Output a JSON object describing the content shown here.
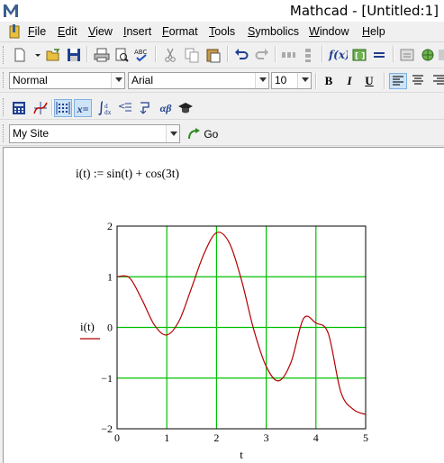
{
  "window": {
    "title": "Mathcad - [Untitled:1]"
  },
  "menu": [
    "File",
    "Edit",
    "View",
    "Insert",
    "Format",
    "Tools",
    "Symbolics",
    "Window",
    "Help"
  ],
  "format_toolbar": {
    "style": "Normal",
    "font": "Arial",
    "size": "10",
    "bold": "B",
    "italic": "I",
    "underline": "U"
  },
  "math_toolbar": {
    "eval_label": "x=",
    "greek_label": "αβ"
  },
  "resources_toolbar": {
    "site": "My Site",
    "go_label": "Go"
  },
  "worksheet": {
    "equation": "i(t) := sin(t) + cos(3t)",
    "y_axis_label": "i(t)",
    "x_axis_label": "t"
  },
  "chart_data": {
    "type": "line",
    "title": "",
    "xlabel": "t",
    "ylabel": "i(t)",
    "xlim": [
      0,
      5
    ],
    "ylim": [
      -2,
      2
    ],
    "x_ticks": [
      "0",
      "1",
      "2",
      "3",
      "4",
      "5"
    ],
    "y_ticks": [
      "2",
      "1",
      "0",
      "−1",
      "−2"
    ],
    "grid": true,
    "series": [
      {
        "function": "sin(t) + cos(3t)",
        "color": "#b40000",
        "x": [
          0,
          0.25,
          0.5,
          0.75,
          1.0,
          1.25,
          1.5,
          1.75,
          2.0,
          2.25,
          2.5,
          2.75,
          3.0,
          3.25,
          3.5,
          3.75,
          4.0,
          4.25,
          4.5,
          4.75,
          5.0
        ],
        "y": [
          1.0,
          0.979,
          0.55,
          0.05,
          -0.149,
          0.133,
          0.786,
          1.457,
          1.869,
          1.683,
          0.945,
          -0.046,
          -0.77,
          -1.055,
          -0.684,
          0.175,
          0.087,
          -0.123,
          -1.272,
          -1.617,
          -1.718
        ]
      }
    ],
    "grid_color": "#00c000"
  }
}
